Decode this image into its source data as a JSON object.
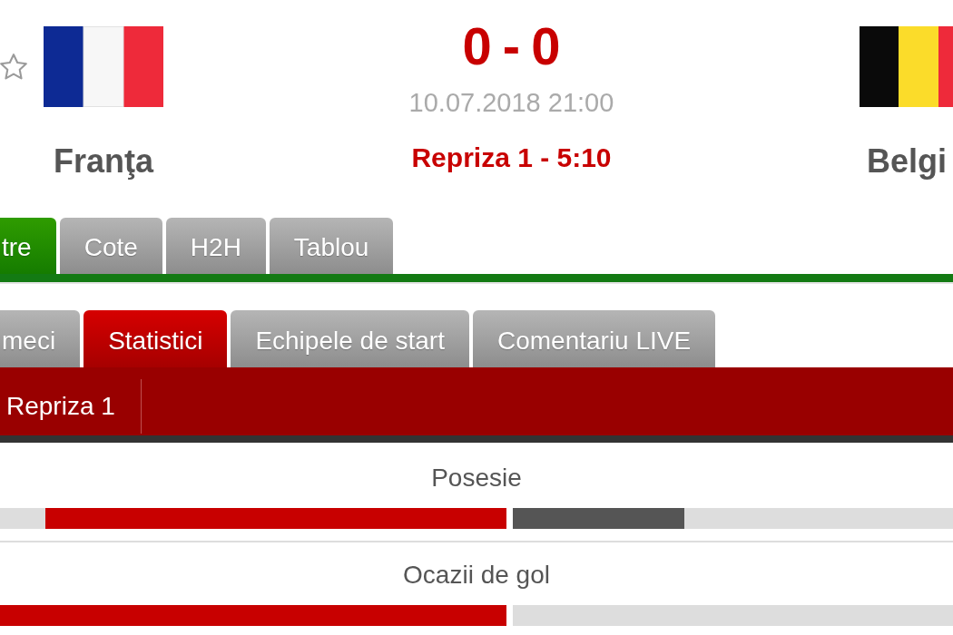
{
  "header": {
    "starred": false,
    "home_team": "Franţa",
    "score": "0 - 0",
    "start_time": "10.07.2018 21:00",
    "status": "Repriza 1 - 5:10",
    "away_team": "Belgi"
  },
  "main_tabs": [
    {
      "label": "tre",
      "selected": true
    },
    {
      "label": "Cote",
      "selected": false
    },
    {
      "label": "H2H",
      "selected": false
    },
    {
      "label": "Tablou",
      "selected": false
    }
  ],
  "sub_tabs": [
    {
      "label": "meci",
      "selected": false
    },
    {
      "label": "Statistici",
      "selected": true
    },
    {
      "label": "Echipele de start",
      "selected": false
    },
    {
      "label": "Comentariu LIVE",
      "selected": false
    }
  ],
  "period_tabs": [
    {
      "label": "Repriza 1",
      "selected": true
    }
  ],
  "stats": [
    {
      "name": "Posesie",
      "home": {
        "level": 0.91
      },
      "away": {
        "level": 0.39
      }
    },
    {
      "name": "Ocazii de gol",
      "home": {
        "level": 1
      },
      "away": {
        "level": 0
      }
    }
  ]
}
